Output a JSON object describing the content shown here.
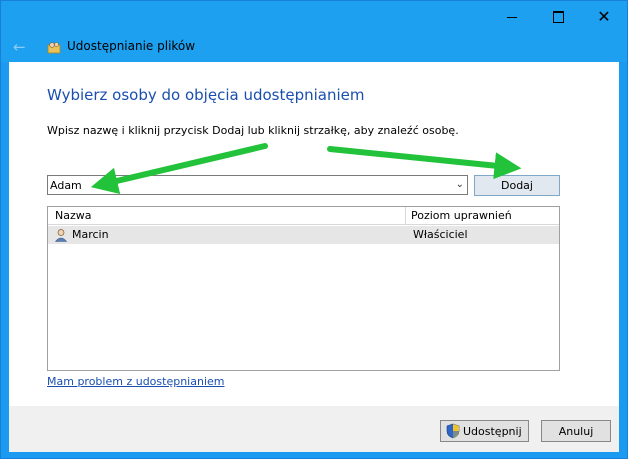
{
  "window": {
    "title": "Udostępnianie plików",
    "minimize_icon": "minimize-icon",
    "maximize_icon": "maximize-icon",
    "close_icon": "close-icon",
    "back_icon": "back-arrow-icon",
    "app_icon": "file-sharing-icon"
  },
  "main": {
    "heading": "Wybierz osoby do objęcia udostępnianiem",
    "instruction": "Wpisz nazwę i kliknij przycisk Dodaj lub kliknij strzałkę, aby znaleźć osobę.",
    "name_input_value": "Adam",
    "add_button_label": "Dodaj",
    "columns": {
      "name": "Nazwa",
      "permission": "Poziom uprawnień"
    },
    "rows": [
      {
        "name": "Marcin",
        "permission": "Właściciel",
        "icon": "user-icon"
      }
    ],
    "help_link": "Mam problem z udostępnianiem"
  },
  "footer": {
    "share_button_label": "Udostępnij",
    "cancel_button_label": "Anuluj",
    "share_icon": "uac-shield-icon"
  },
  "colors": {
    "title_bar": "#1ea0f0",
    "heading": "#1a4fb0",
    "annotation_arrows": "#22c23a"
  }
}
